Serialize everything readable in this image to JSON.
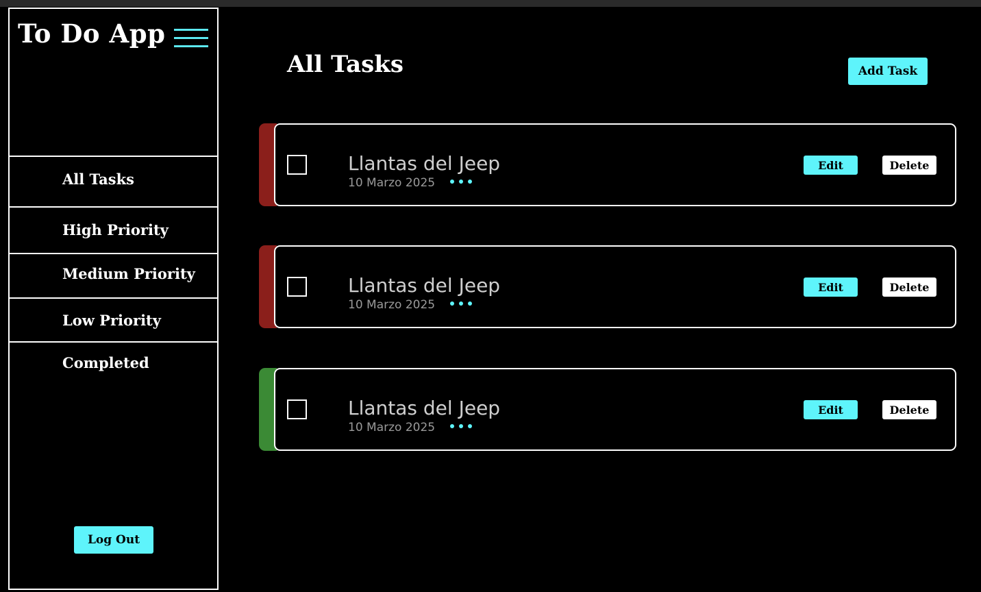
{
  "app": {
    "title": "To Do App"
  },
  "sidebar": {
    "menu_icon": "hamburger-menu-icon",
    "items": [
      {
        "label": "All Tasks"
      },
      {
        "label": "High Priority"
      },
      {
        "label": "Medium Priority"
      },
      {
        "label": "Low Priority"
      },
      {
        "label": "Completed"
      }
    ],
    "logout_label": "Log Out"
  },
  "main": {
    "title": "All Tasks",
    "add_label": "Add Task"
  },
  "tasks": [
    {
      "title": "Llantas del Jeep",
      "date": "10 Marzo 2025",
      "priority_color": "#8b1f1b",
      "completed": false,
      "edit_label": "Edit",
      "delete_label": "Delete"
    },
    {
      "title": "Llantas del Jeep",
      "date": "10 Marzo 2025",
      "priority_color": "#8b1f1b",
      "completed": false,
      "edit_label": "Edit",
      "delete_label": "Delete"
    },
    {
      "title": "Llantas del Jeep",
      "date": "10 Marzo 2025",
      "priority_color": "#3b8a35",
      "completed": false,
      "edit_label": "Edit",
      "delete_label": "Delete"
    }
  ],
  "colors": {
    "accent": "#5ef4fb",
    "background": "#000000",
    "border": "#ffffff"
  }
}
